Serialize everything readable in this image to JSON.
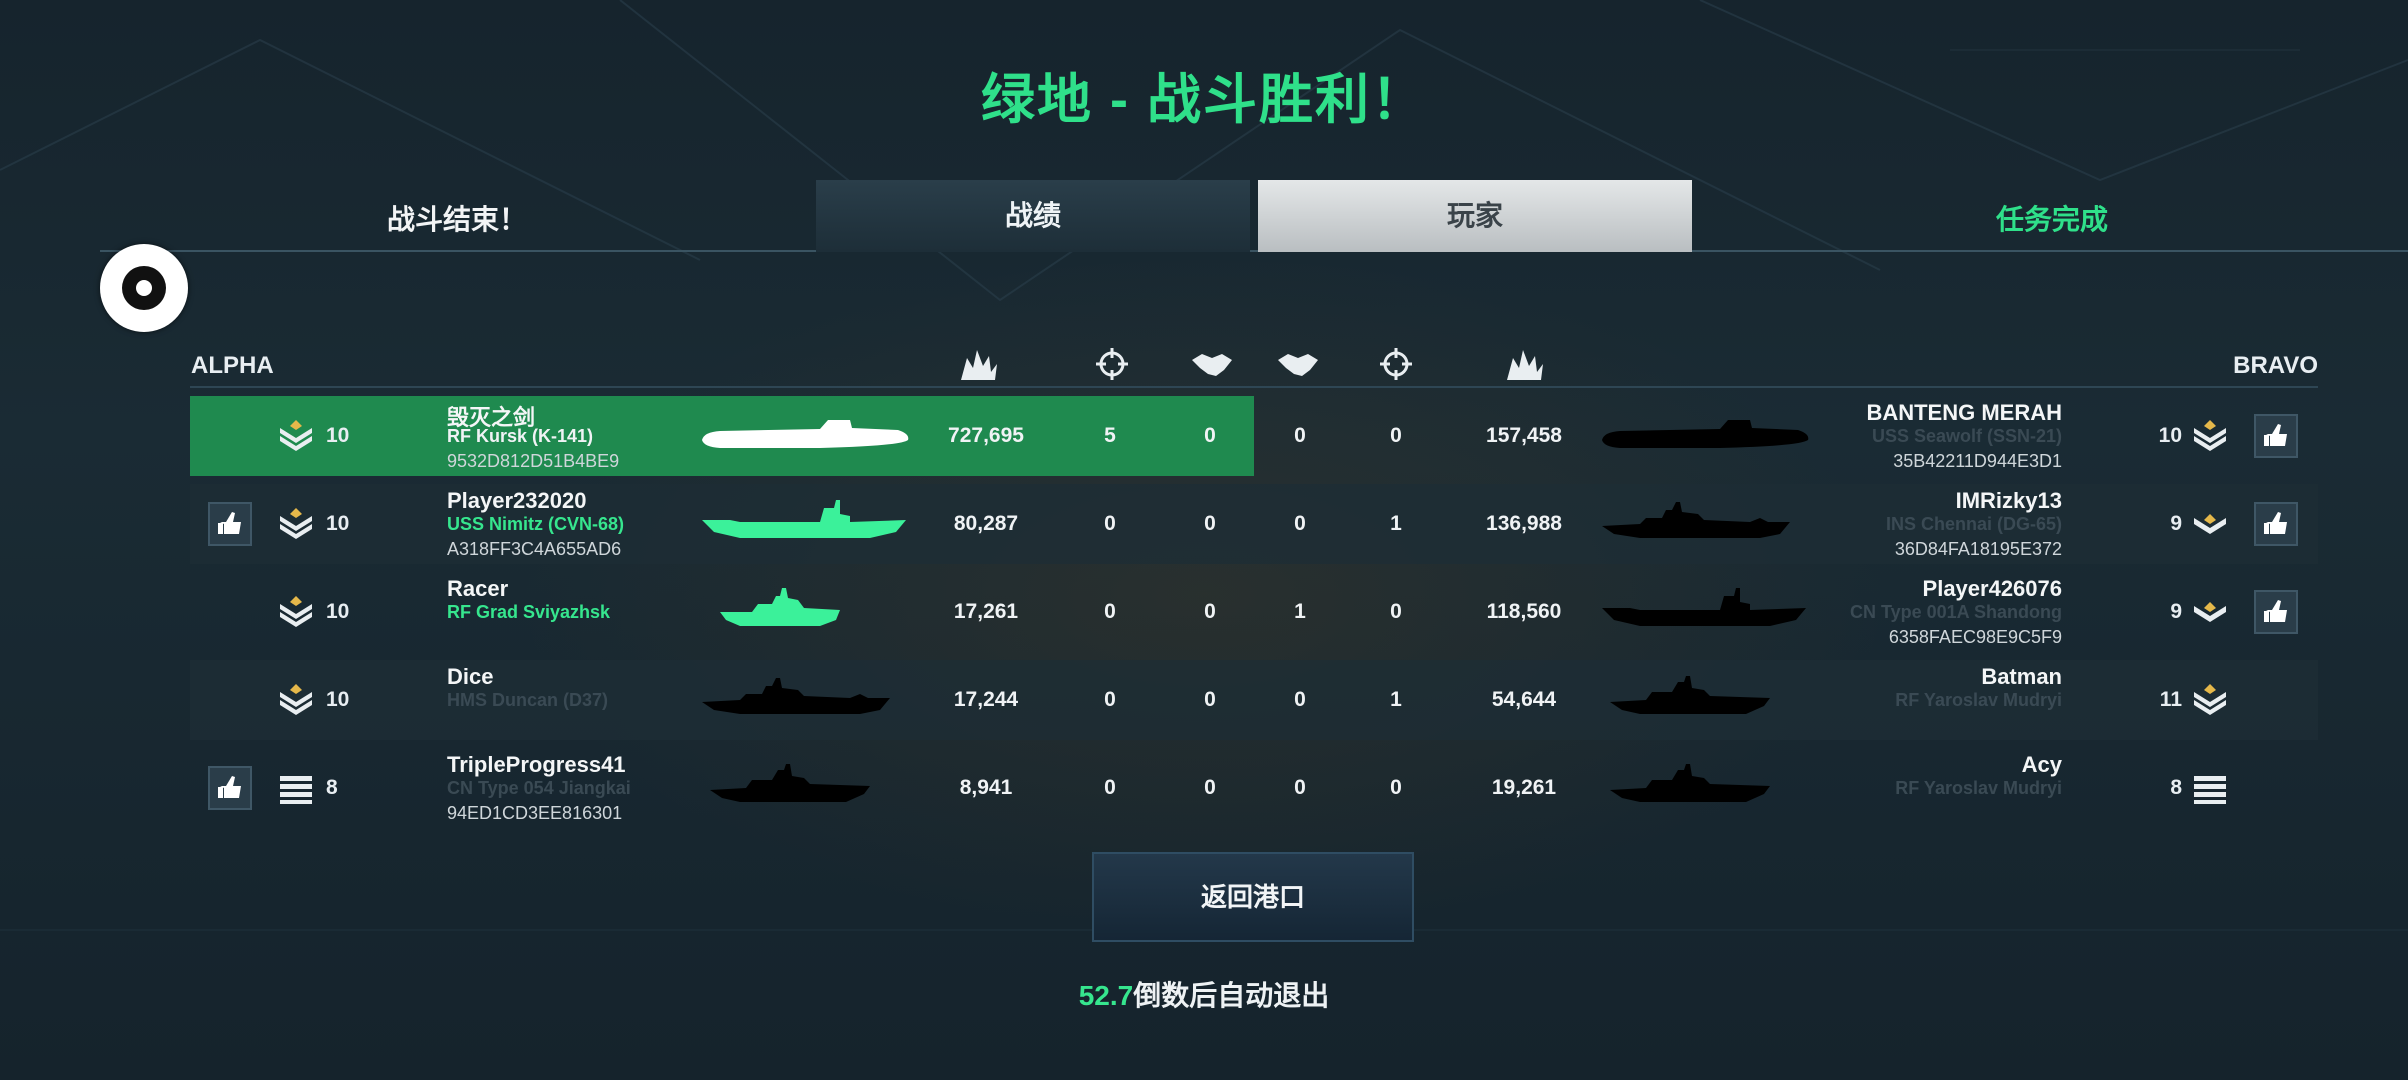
{
  "title": "绿地 - 战斗胜利！",
  "header": {
    "left_label": "战斗结束！",
    "tabs": [
      {
        "label": "战绩",
        "active": false
      },
      {
        "label": "玩家",
        "active": true
      }
    ],
    "right_label": "任务完成"
  },
  "teams": {
    "alpha": "ALPHA",
    "bravo": "BRAVO"
  },
  "column_icons": [
    "damage-icon",
    "crosshair-icon",
    "handshake-icon",
    "handshake-icon",
    "crosshair-icon",
    "damage-icon"
  ],
  "rows": [
    {
      "alpha": {
        "thumb": false,
        "rank_icon": "rank-chevron-gold-icon",
        "level": "10",
        "name": "毁灭之剑",
        "ship": "RF Kursk (K-141)",
        "ship_color": "white",
        "id": "9532D812D51B4BE9",
        "silhouette": "submarine",
        "silhouette_color": "#ffffff",
        "score": "727,695",
        "kills": "5",
        "assists": "0"
      },
      "bravo": {
        "thumb": true,
        "rank_icon": "rank-chevron-gold-icon",
        "level": "10",
        "name": "BANTENG MERAH",
        "ship": "USS Seawolf (SSN-21)",
        "ship_color": "dim",
        "id": "35B42211D944E3D1",
        "silhouette": "submarine",
        "silhouette_color": "#000000",
        "score": "157,458",
        "kills": "0",
        "assists": "0"
      },
      "highlight": true,
      "dark": false
    },
    {
      "alpha": {
        "thumb": true,
        "rank_icon": "rank-chevron-gold-icon",
        "level": "10",
        "name": "Player232020",
        "ship": "USS Nimitz (CVN-68)",
        "ship_color": "green",
        "id": "A318FF3C4A655AD6",
        "silhouette": "carrier",
        "silhouette_color": "#3bf19a",
        "score": "80,287",
        "kills": "0",
        "assists": "0"
      },
      "bravo": {
        "thumb": true,
        "rank_icon": "rank-chevron-small-icon",
        "level": "9",
        "name": "IMRizky13",
        "ship": "INS Chennai (DG-65)",
        "ship_color": "dim",
        "id": "36D84FA18195E372",
        "silhouette": "destroyer",
        "silhouette_color": "#000000",
        "score": "136,988",
        "kills": "1",
        "assists": "0"
      },
      "highlight": false,
      "dark": true
    },
    {
      "alpha": {
        "thumb": false,
        "rank_icon": "rank-chevron-gold-icon",
        "level": "10",
        "name": "Racer",
        "ship": "RF Grad Sviyazhsk",
        "ship_color": "green",
        "id": "",
        "silhouette": "corvette",
        "silhouette_color": "#3bf19a",
        "score": "17,261",
        "kills": "0",
        "assists": "0"
      },
      "bravo": {
        "thumb": true,
        "rank_icon": "rank-chevron-small-icon",
        "level": "9",
        "name": "Player426076",
        "ship": "CN Type 001A Shandong",
        "ship_color": "dim",
        "id": "6358FAEC98E9C5F9",
        "silhouette": "carrier",
        "silhouette_color": "#000000",
        "score": "118,560",
        "kills": "0",
        "assists": "1"
      },
      "highlight": false,
      "dark": false
    },
    {
      "alpha": {
        "thumb": false,
        "rank_icon": "rank-chevron-gold-icon",
        "level": "10",
        "name": "Dice",
        "ship": "HMS Duncan (D37)",
        "ship_color": "dim",
        "id": "",
        "silhouette": "destroyer",
        "silhouette_color": "#000000",
        "score": "17,244",
        "kills": "0",
        "assists": "0"
      },
      "bravo": {
        "thumb": false,
        "rank_icon": "rank-chevron-gold-icon",
        "level": "11",
        "name": "Batman",
        "ship": "RF Yaroslav Mudryi",
        "ship_color": "dim",
        "id": "",
        "silhouette": "frigate",
        "silhouette_color": "#000000",
        "score": "54,644",
        "kills": "1",
        "assists": "0"
      },
      "highlight": false,
      "dark": true
    },
    {
      "alpha": {
        "thumb": true,
        "rank_icon": "rank-bars-icon",
        "level": "8",
        "name": "TripleProgress41",
        "ship": "CN Type 054 Jiangkai",
        "ship_color": "dim",
        "id": "94ED1CD3EE816301",
        "silhouette": "frigate",
        "silhouette_color": "#000000",
        "score": "8,941",
        "kills": "0",
        "assists": "0"
      },
      "bravo": {
        "thumb": false,
        "rank_icon": "rank-bars-icon",
        "level": "8",
        "name": "Acy",
        "ship": "RF Yaroslav Mudryi",
        "ship_color": "dim",
        "id": "",
        "silhouette": "frigate",
        "silhouette_color": "#000000",
        "score": "19,261",
        "kills": "0",
        "assists": "0"
      },
      "highlight": false,
      "dark": false
    }
  ],
  "exit_button": "返回港口",
  "countdown": {
    "seconds": "52.7",
    "text": "倒数后自动退出"
  },
  "colors": {
    "accent_green": "#2fe08a",
    "highlight_row": "#1f8a4f",
    "background": "#16242d"
  }
}
